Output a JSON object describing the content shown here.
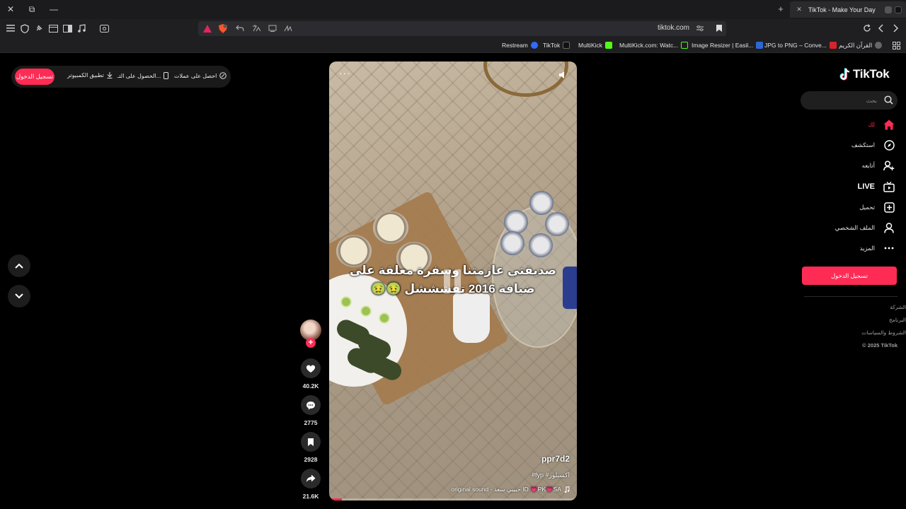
{
  "browser": {
    "tab_title": "TikTok - Make Your Day",
    "new_tab_symbol": "+",
    "address_url": "tiktok.com",
    "window_close": "✕",
    "window_restore": "⧉",
    "window_minimize": "—",
    "bookmarks": [
      {
        "label": "Restream",
        "fav_color": "#2f6bff"
      },
      {
        "label": "TikTok",
        "fav_color": "#111111"
      },
      {
        "label": "MultiKick",
        "fav_color": "#53fc18"
      },
      {
        "label": "MultiKick.com: Watc...",
        "fav_color": "#1e1e1e"
      },
      {
        "label": "Image Resizer | Easil...",
        "fav_color": "#2b68d6"
      },
      {
        "label": "JPG to PNG – Conve...",
        "fav_color": "#d8232a"
      },
      {
        "label": "القرآن الكريم",
        "fav_color": "#666666"
      }
    ]
  },
  "top_actions": {
    "login": "تسجيل الدخول",
    "desktop_app": "تطبيق الكمبيوتر",
    "get_app": "الحصول على التـ...",
    "get_coins": "احصل على عملات"
  },
  "video": {
    "caption": "صديقتي عازمتنا وسفرة معلقة على ضيافة 2016 تفشششل 🤢🤢",
    "author": "ppr7d2",
    "hashtags": "#fyp #اكسبلور",
    "sound": "original sound - حبيبي سعد ID 💗PK💗SA",
    "more": "···",
    "progress": 0.05
  },
  "actions": {
    "follow_plus": "+",
    "likes": "40.2K",
    "comments": "2775",
    "saves": "2928",
    "shares": "21.6K"
  },
  "sidebar": {
    "logo": "TikTok",
    "search_placeholder": "بحث",
    "nav": [
      {
        "label": "لك",
        "icon": "home-icon",
        "active": true
      },
      {
        "label": "استكشف",
        "icon": "compass-icon"
      },
      {
        "label": "أتابعه",
        "icon": "user-follow-icon"
      },
      {
        "label": "LIVE",
        "icon": "live-tv-icon"
      },
      {
        "label": "تحميل",
        "icon": "upload-plus-icon"
      },
      {
        "label": "الملف الشخصي",
        "icon": "profile-icon"
      },
      {
        "label": "المزيد",
        "icon": "more-icon"
      }
    ],
    "login_button": "تسجيل الدخول",
    "footer": [
      "الشركة",
      "البرنامج",
      "الشروط والسياسات",
      "© 2025 TikTok"
    ]
  },
  "colors": {
    "accent": "#fe2c55",
    "background": "#000000"
  }
}
